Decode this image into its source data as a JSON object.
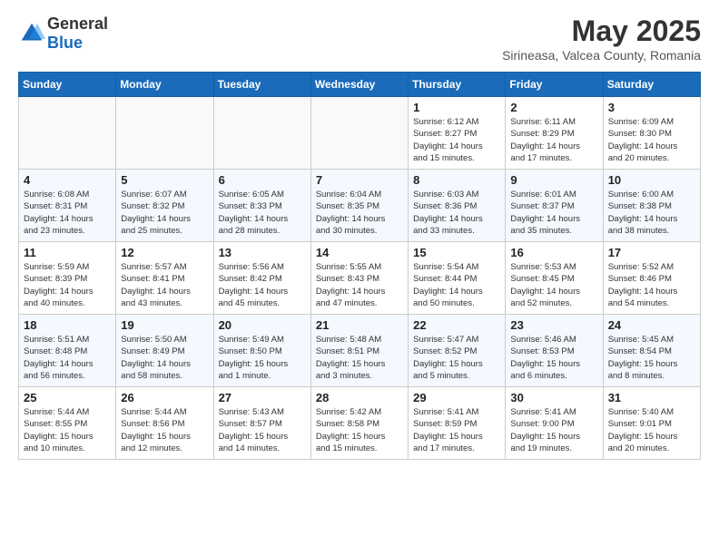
{
  "logo": {
    "general": "General",
    "blue": "Blue"
  },
  "header": {
    "month": "May 2025",
    "location": "Sirineasa, Valcea County, Romania"
  },
  "weekdays": [
    "Sunday",
    "Monday",
    "Tuesday",
    "Wednesday",
    "Thursday",
    "Friday",
    "Saturday"
  ],
  "weeks": [
    [
      {
        "day": "",
        "info": ""
      },
      {
        "day": "",
        "info": ""
      },
      {
        "day": "",
        "info": ""
      },
      {
        "day": "",
        "info": ""
      },
      {
        "day": "1",
        "info": "Sunrise: 6:12 AM\nSunset: 8:27 PM\nDaylight: 14 hours\nand 15 minutes."
      },
      {
        "day": "2",
        "info": "Sunrise: 6:11 AM\nSunset: 8:29 PM\nDaylight: 14 hours\nand 17 minutes."
      },
      {
        "day": "3",
        "info": "Sunrise: 6:09 AM\nSunset: 8:30 PM\nDaylight: 14 hours\nand 20 minutes."
      }
    ],
    [
      {
        "day": "4",
        "info": "Sunrise: 6:08 AM\nSunset: 8:31 PM\nDaylight: 14 hours\nand 23 minutes."
      },
      {
        "day": "5",
        "info": "Sunrise: 6:07 AM\nSunset: 8:32 PM\nDaylight: 14 hours\nand 25 minutes."
      },
      {
        "day": "6",
        "info": "Sunrise: 6:05 AM\nSunset: 8:33 PM\nDaylight: 14 hours\nand 28 minutes."
      },
      {
        "day": "7",
        "info": "Sunrise: 6:04 AM\nSunset: 8:35 PM\nDaylight: 14 hours\nand 30 minutes."
      },
      {
        "day": "8",
        "info": "Sunrise: 6:03 AM\nSunset: 8:36 PM\nDaylight: 14 hours\nand 33 minutes."
      },
      {
        "day": "9",
        "info": "Sunrise: 6:01 AM\nSunset: 8:37 PM\nDaylight: 14 hours\nand 35 minutes."
      },
      {
        "day": "10",
        "info": "Sunrise: 6:00 AM\nSunset: 8:38 PM\nDaylight: 14 hours\nand 38 minutes."
      }
    ],
    [
      {
        "day": "11",
        "info": "Sunrise: 5:59 AM\nSunset: 8:39 PM\nDaylight: 14 hours\nand 40 minutes."
      },
      {
        "day": "12",
        "info": "Sunrise: 5:57 AM\nSunset: 8:41 PM\nDaylight: 14 hours\nand 43 minutes."
      },
      {
        "day": "13",
        "info": "Sunrise: 5:56 AM\nSunset: 8:42 PM\nDaylight: 14 hours\nand 45 minutes."
      },
      {
        "day": "14",
        "info": "Sunrise: 5:55 AM\nSunset: 8:43 PM\nDaylight: 14 hours\nand 47 minutes."
      },
      {
        "day": "15",
        "info": "Sunrise: 5:54 AM\nSunset: 8:44 PM\nDaylight: 14 hours\nand 50 minutes."
      },
      {
        "day": "16",
        "info": "Sunrise: 5:53 AM\nSunset: 8:45 PM\nDaylight: 14 hours\nand 52 minutes."
      },
      {
        "day": "17",
        "info": "Sunrise: 5:52 AM\nSunset: 8:46 PM\nDaylight: 14 hours\nand 54 minutes."
      }
    ],
    [
      {
        "day": "18",
        "info": "Sunrise: 5:51 AM\nSunset: 8:48 PM\nDaylight: 14 hours\nand 56 minutes."
      },
      {
        "day": "19",
        "info": "Sunrise: 5:50 AM\nSunset: 8:49 PM\nDaylight: 14 hours\nand 58 minutes."
      },
      {
        "day": "20",
        "info": "Sunrise: 5:49 AM\nSunset: 8:50 PM\nDaylight: 15 hours\nand 1 minute."
      },
      {
        "day": "21",
        "info": "Sunrise: 5:48 AM\nSunset: 8:51 PM\nDaylight: 15 hours\nand 3 minutes."
      },
      {
        "day": "22",
        "info": "Sunrise: 5:47 AM\nSunset: 8:52 PM\nDaylight: 15 hours\nand 5 minutes."
      },
      {
        "day": "23",
        "info": "Sunrise: 5:46 AM\nSunset: 8:53 PM\nDaylight: 15 hours\nand 6 minutes."
      },
      {
        "day": "24",
        "info": "Sunrise: 5:45 AM\nSunset: 8:54 PM\nDaylight: 15 hours\nand 8 minutes."
      }
    ],
    [
      {
        "day": "25",
        "info": "Sunrise: 5:44 AM\nSunset: 8:55 PM\nDaylight: 15 hours\nand 10 minutes."
      },
      {
        "day": "26",
        "info": "Sunrise: 5:44 AM\nSunset: 8:56 PM\nDaylight: 15 hours\nand 12 minutes."
      },
      {
        "day": "27",
        "info": "Sunrise: 5:43 AM\nSunset: 8:57 PM\nDaylight: 15 hours\nand 14 minutes."
      },
      {
        "day": "28",
        "info": "Sunrise: 5:42 AM\nSunset: 8:58 PM\nDaylight: 15 hours\nand 15 minutes."
      },
      {
        "day": "29",
        "info": "Sunrise: 5:41 AM\nSunset: 8:59 PM\nDaylight: 15 hours\nand 17 minutes."
      },
      {
        "day": "30",
        "info": "Sunrise: 5:41 AM\nSunset: 9:00 PM\nDaylight: 15 hours\nand 19 minutes."
      },
      {
        "day": "31",
        "info": "Sunrise: 5:40 AM\nSunset: 9:01 PM\nDaylight: 15 hours\nand 20 minutes."
      }
    ]
  ]
}
